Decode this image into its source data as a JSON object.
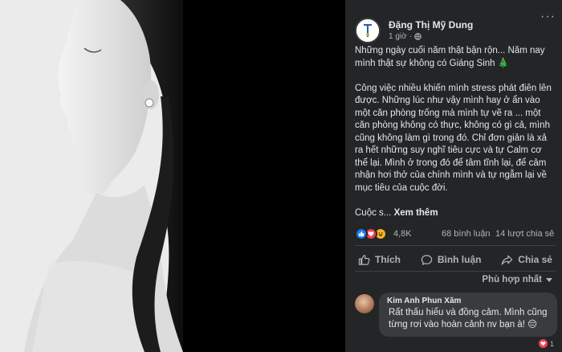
{
  "post": {
    "author": "Đặng Thị Mỹ Dung",
    "time": "1 giờ",
    "privacy_dot": "·",
    "more_label": "···",
    "paragraphs": [
      "Những ngày cuối năm thật bận rộn... Năm nay mình thật sự không có Giáng Sinh 🎄",
      "Công việc nhiều khiến mình stress phát điên lên được. Những lúc như vậy mình hay ở ẩn vào một căn phòng trống mà mình tự vẽ ra ... một căn phòng không có thực, không có gì cả, mình cũng không làm gì trong đó. Chỉ đơn giản là xả ra hết những suy nghĩ tiêu cực và tự Calm cơ thể lại. Mình ở trong đó để tâm tĩnh lại, để cảm nhận hơi thở của chính mình và tự ngẫm lại về mục tiêu của cuộc đời."
    ],
    "truncated_text": "Cuộc s...",
    "see_more": "Xem thêm"
  },
  "stats": {
    "reaction_count": "4,8K",
    "comments": "68 bình luận",
    "shares": "14 lượt chia sẻ"
  },
  "actions": {
    "like": "Thích",
    "comment": "Bình luận",
    "share": "Chia sẻ"
  },
  "sort_label": "Phù hợp nhất",
  "comment": {
    "name": "Kim Anh Phun Xăm",
    "text": "Rất thấu hiểu và đồng cảm. Mình cũng từng rơi vào hoàn cảnh nv bạn à! 😔",
    "reaction_count": "1"
  },
  "colors": {
    "panel_bg": "#242526",
    "like_blue": "#1877f2",
    "heart_red": "#f33e58",
    "haha_yellow": "#f7b125"
  },
  "icons": {
    "privacy": "globe-icon",
    "like": "thumbs-up-icon",
    "comment": "speech-bubble-icon",
    "share": "share-arrow-icon"
  }
}
